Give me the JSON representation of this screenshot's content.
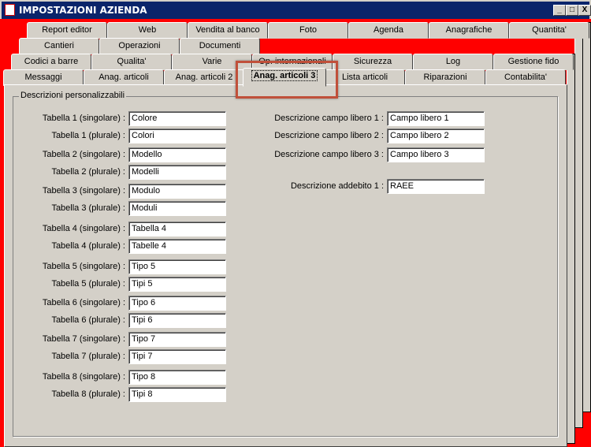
{
  "window": {
    "title": "IMPOSTAZIONI AZIENDA",
    "min": "_",
    "max": "□",
    "close": "X"
  },
  "tabs": {
    "row1": [
      "Report editor",
      "Web",
      "Vendita al banco",
      "Foto",
      "Agenda",
      "Anagrafiche",
      "Quantita'"
    ],
    "row2": [
      "Cantieri",
      "Operazioni",
      "Documenti"
    ],
    "row3": [
      "Codici a barre",
      "Qualita'",
      "Varie",
      "Op. internazionali",
      "Sicurezza",
      "Log",
      "Gestione fido"
    ],
    "row4": [
      "Messaggi",
      "Anag. articoli",
      "Anag. articoli 2",
      "Anag. articoli 3",
      "Lista articoli",
      "Riparazioni",
      "Contabilita'"
    ]
  },
  "group": {
    "title": "Descrizioni personalizzabili"
  },
  "left_fields": [
    {
      "label": "Tabella 1 (singolare) :",
      "value": "Colore"
    },
    {
      "label": "Tabella 1 (plurale) :",
      "value": "Colori"
    },
    {
      "label": "Tabella 2 (singolare) :",
      "value": "Modello"
    },
    {
      "label": "Tabella 2 (plurale) :",
      "value": "Modelli"
    },
    {
      "label": "Tabella 3 (singolare) :",
      "value": "Modulo"
    },
    {
      "label": "Tabella 3 (plurale) :",
      "value": "Moduli"
    },
    {
      "label": "Tabella 4 (singolare) :",
      "value": "Tabella 4"
    },
    {
      "label": "Tabella 4 (plurale) :",
      "value": "Tabelle 4"
    },
    {
      "label": "Tabella 5 (singolare) :",
      "value": "Tipo 5"
    },
    {
      "label": "Tabella 5 (plurale) :",
      "value": "Tipi 5"
    },
    {
      "label": "Tabella 6 (singolare) :",
      "value": "Tipo 6"
    },
    {
      "label": "Tabella 6 (plurale) :",
      "value": "Tipi 6"
    },
    {
      "label": "Tabella 7 (singolare) :",
      "value": "Tipo 7"
    },
    {
      "label": "Tabella 7 (plurale) :",
      "value": "Tipi 7"
    },
    {
      "label": "Tabella 8 (singolare) :",
      "value": "Tipo 8"
    },
    {
      "label": "Tabella 8 (plurale) :",
      "value": "Tipi 8"
    }
  ],
  "right_fields": [
    {
      "label": "Descrizione campo libero 1 :",
      "value": "Campo libero 1"
    },
    {
      "label": "Descrizione campo libero 2 :",
      "value": "Campo libero 2"
    },
    {
      "label": "Descrizione campo libero 3 :",
      "value": "Campo libero 3"
    },
    {
      "label": "Descrizione addebito 1 :",
      "value": "RAEE"
    }
  ]
}
